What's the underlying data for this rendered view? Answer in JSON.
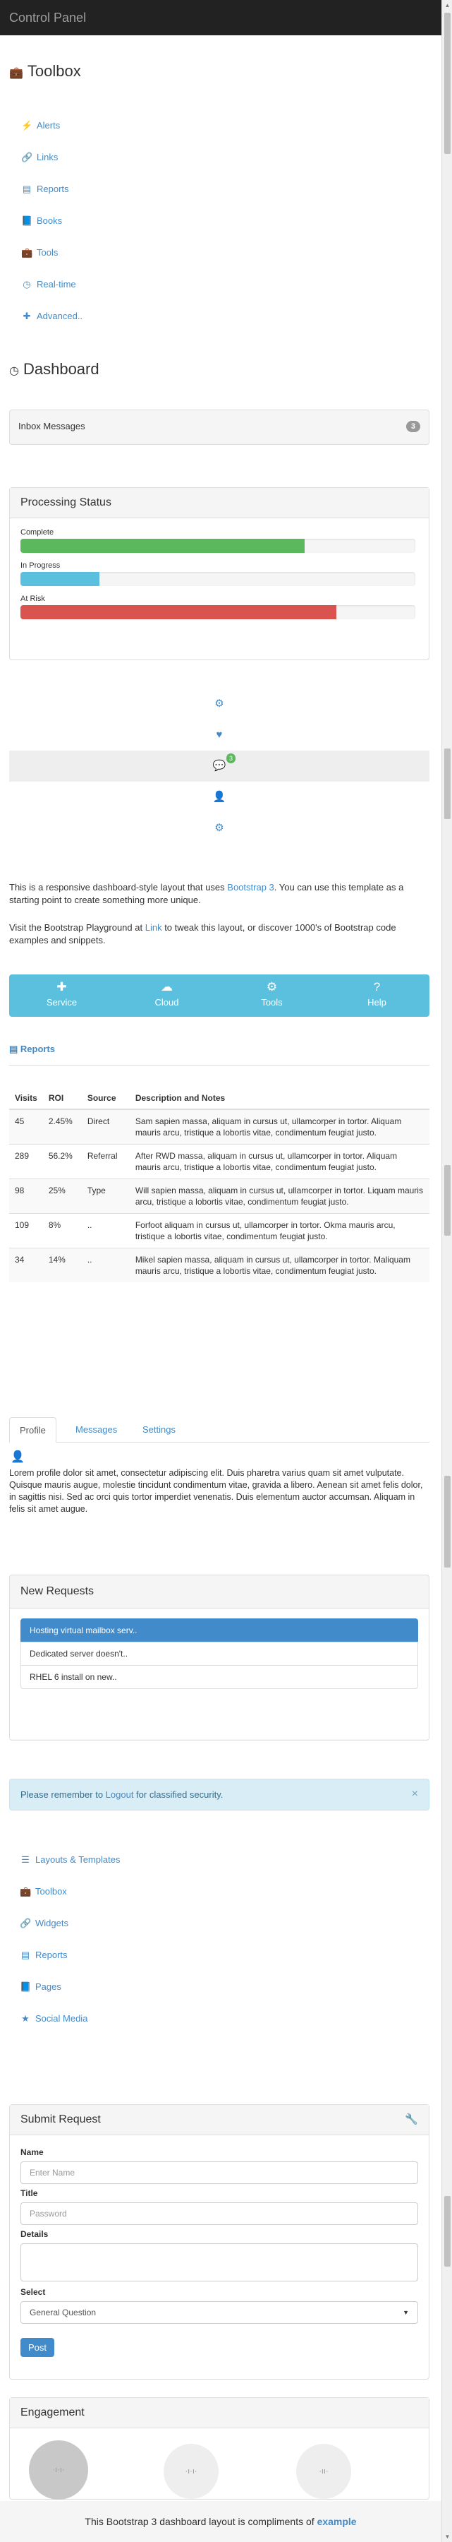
{
  "navbar": {
    "brand": "Control Panel"
  },
  "toolbox": {
    "title": "Toolbox",
    "links": [
      {
        "label": "Alerts",
        "icon": "bolt-icon",
        "glyph": "⚡"
      },
      {
        "label": "Links",
        "icon": "link-icon",
        "glyph": "🔗"
      },
      {
        "label": "Reports",
        "icon": "list-alt-icon",
        "glyph": "▤"
      },
      {
        "label": "Books",
        "icon": "book-icon",
        "glyph": "📘"
      },
      {
        "label": "Tools",
        "icon": "briefcase-icon",
        "glyph": "💼"
      },
      {
        "label": "Real-time",
        "icon": "clock-icon",
        "glyph": "◷"
      },
      {
        "label": "Advanced..",
        "icon": "plus-icon",
        "glyph": "✚"
      }
    ]
  },
  "dashboard": {
    "title": "Dashboard",
    "inbox": {
      "label": "Inbox Messages",
      "count": "3"
    },
    "processing": {
      "title": "Processing Status",
      "bars": [
        {
          "label": "Complete",
          "value": 0.72,
          "color": "#5cb85c"
        },
        {
          "label": "In Progress",
          "value": 0.2,
          "color": "#5bc0de"
        },
        {
          "label": "At Risk",
          "value": 0.8,
          "color": "#d9534f"
        }
      ]
    },
    "icon_stack": {
      "chat_badge": "3",
      "icons": [
        "cog-icon",
        "heart-icon",
        "comment-icon",
        "user-icon",
        "cog-icon"
      ]
    },
    "intro_prefix": "This is a responsive dashboard-style layout that uses ",
    "intro_link": "Bootstrap 3",
    "intro_suffix": ". You can use this template as a starting point to create something more unique.",
    "visit_prefix": "Visit the Bootstrap Playground at ",
    "visit_link": "Link",
    "visit_suffix": " to tweak this layout, or discover 1000's of Bootstrap code examples and snippets.",
    "tiles": [
      {
        "label": "Service",
        "icon": "plus-icon",
        "glyph": "✚"
      },
      {
        "label": "Cloud",
        "icon": "cloud-icon",
        "glyph": "☁"
      },
      {
        "label": "Tools",
        "icon": "cog-icon",
        "glyph": "⚙"
      },
      {
        "label": "Help",
        "icon": "question-icon",
        "glyph": "?"
      }
    ]
  },
  "reports": {
    "title": "Reports",
    "headers": [
      "Visits",
      "ROI",
      "Source",
      "Description and Notes"
    ],
    "rows": [
      [
        "45",
        "2.45%",
        "Direct",
        "Sam sapien massa, aliquam in cursus ut, ullamcorper in tortor. Aliquam mauris arcu, tristique a lobortis vitae, condimentum feugiat justo."
      ],
      [
        "289",
        "56.2%",
        "Referral",
        "After RWD massa, aliquam in cursus ut, ullamcorper in tortor. Aliquam mauris arcu, tristique a lobortis vitae, condimentum feugiat justo."
      ],
      [
        "98",
        "25%",
        "Type",
        "Will sapien massa, aliquam in cursus ut, ullamcorper in tortor. Liquam mauris arcu, tristique a lobortis vitae, condimentum feugiat justo."
      ],
      [
        "109",
        "8%",
        "..",
        "Forfoot aliquam in cursus ut, ullamcorper in tortor. Okma mauris arcu, tristique a lobortis vitae, condimentum feugiat justo."
      ],
      [
        "34",
        "14%",
        "..",
        "Mikel sapien massa, aliquam in cursus ut, ullamcorper in tortor. Maliquam mauris arcu, tristique a lobortis vitae, condimentum feugiat justo."
      ]
    ]
  },
  "tabs": {
    "items": [
      "Profile",
      "Messages",
      "Settings"
    ],
    "para1": "Lorem profile dolor sit amet, consectetur adipiscing elit. Duis pharetra varius quam sit amet vulputate.",
    "para2": "Quisque mauris augue, molestie tincidunt condimentum vitae, gravida a libero. Aenean sit amet felis dolor, in sagittis nisi. Sed ac orci quis tortor imperdiet venenatis. Duis elementum auctor accumsan. Aliquam in felis sit amet augue."
  },
  "requests": {
    "title": "New Requests",
    "items": [
      "Hosting virtual mailbox serv..",
      "Dedicated server doesn't..",
      "RHEL 6 install on new.."
    ]
  },
  "alert": {
    "prefix": "Please remember to ",
    "link": "Logout",
    "suffix": " for classified security.",
    "close": "×"
  },
  "bottom_links": [
    {
      "label": "Layouts & Templates",
      "icon": "list-icon",
      "glyph": "☰"
    },
    {
      "label": "Toolbox",
      "icon": "briefcase-icon",
      "glyph": "💼"
    },
    {
      "label": "Widgets",
      "icon": "link-icon",
      "glyph": "🔗"
    },
    {
      "label": "Reports",
      "icon": "list-alt-icon",
      "glyph": "▤"
    },
    {
      "label": "Pages",
      "icon": "book-icon",
      "glyph": "📘"
    },
    {
      "label": "Social Media",
      "icon": "star-icon",
      "glyph": "★"
    }
  ],
  "submit_form": {
    "title": "Submit Request",
    "name_label": "Name",
    "name_placeholder": "Enter Name",
    "title_label": "Title",
    "title_placeholder": "Password",
    "details_label": "Details",
    "select_label": "Select",
    "select_value": "General Question",
    "submit": "Post"
  },
  "engagement": {
    "title": "Engagement",
    "gauge_labels": [
      "·ı·ı·",
      "·ı·ı·",
      "·ıı·"
    ]
  },
  "footer": {
    "prefix": "This Bootstrap 3 dashboard layout is compliments of ",
    "link": "example"
  }
}
